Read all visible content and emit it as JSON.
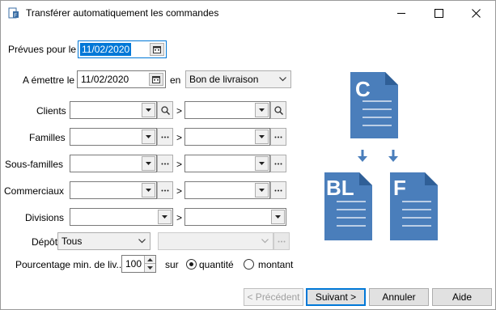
{
  "window": {
    "title": "Transférer automatiquement les commandes",
    "minimize_icon": "minimize-icon",
    "maximize_icon": "maximize-icon",
    "close_icon": "close-icon"
  },
  "prevues": {
    "label": "Prévues pour le",
    "value": "11/02/2020"
  },
  "emettre": {
    "label": "A émettre le",
    "value": "11/02/2020",
    "en_label": "en",
    "doc_type": "Bon de livraison"
  },
  "filters": [
    {
      "label": "Clients",
      "from": "",
      "to": "",
      "button_icon": "search-icon"
    },
    {
      "label": "Familles",
      "from": "",
      "to": "",
      "button_icon": "more-icon"
    },
    {
      "label": "Sous-familles",
      "from": "",
      "to": "",
      "button_icon": "more-icon"
    },
    {
      "label": "Commerciaux",
      "from": "",
      "to": "",
      "button_icon": "more-icon"
    },
    {
      "label": "Divisions",
      "from": "",
      "to": "",
      "button_icon": ""
    }
  ],
  "range_separator": ">",
  "depots": {
    "label": "Dépôts",
    "value": "Tous",
    "second_value": ""
  },
  "pourcentage": {
    "label": "Pourcentage min. de liv...",
    "value": "100",
    "sur_label": "sur",
    "option_quantite": "quantité",
    "option_montant": "montant",
    "selected": "quantité"
  },
  "illustration": {
    "doc_c_letter": "C",
    "doc_bl_letter": "BL",
    "doc_f_letter": "F",
    "doc_color": "#4a7ebb",
    "arrow_color": "#4a7ebb"
  },
  "buttons": {
    "previous": "< Précédent",
    "next": "Suivant >",
    "cancel": "Annuler",
    "help": "Aide"
  }
}
